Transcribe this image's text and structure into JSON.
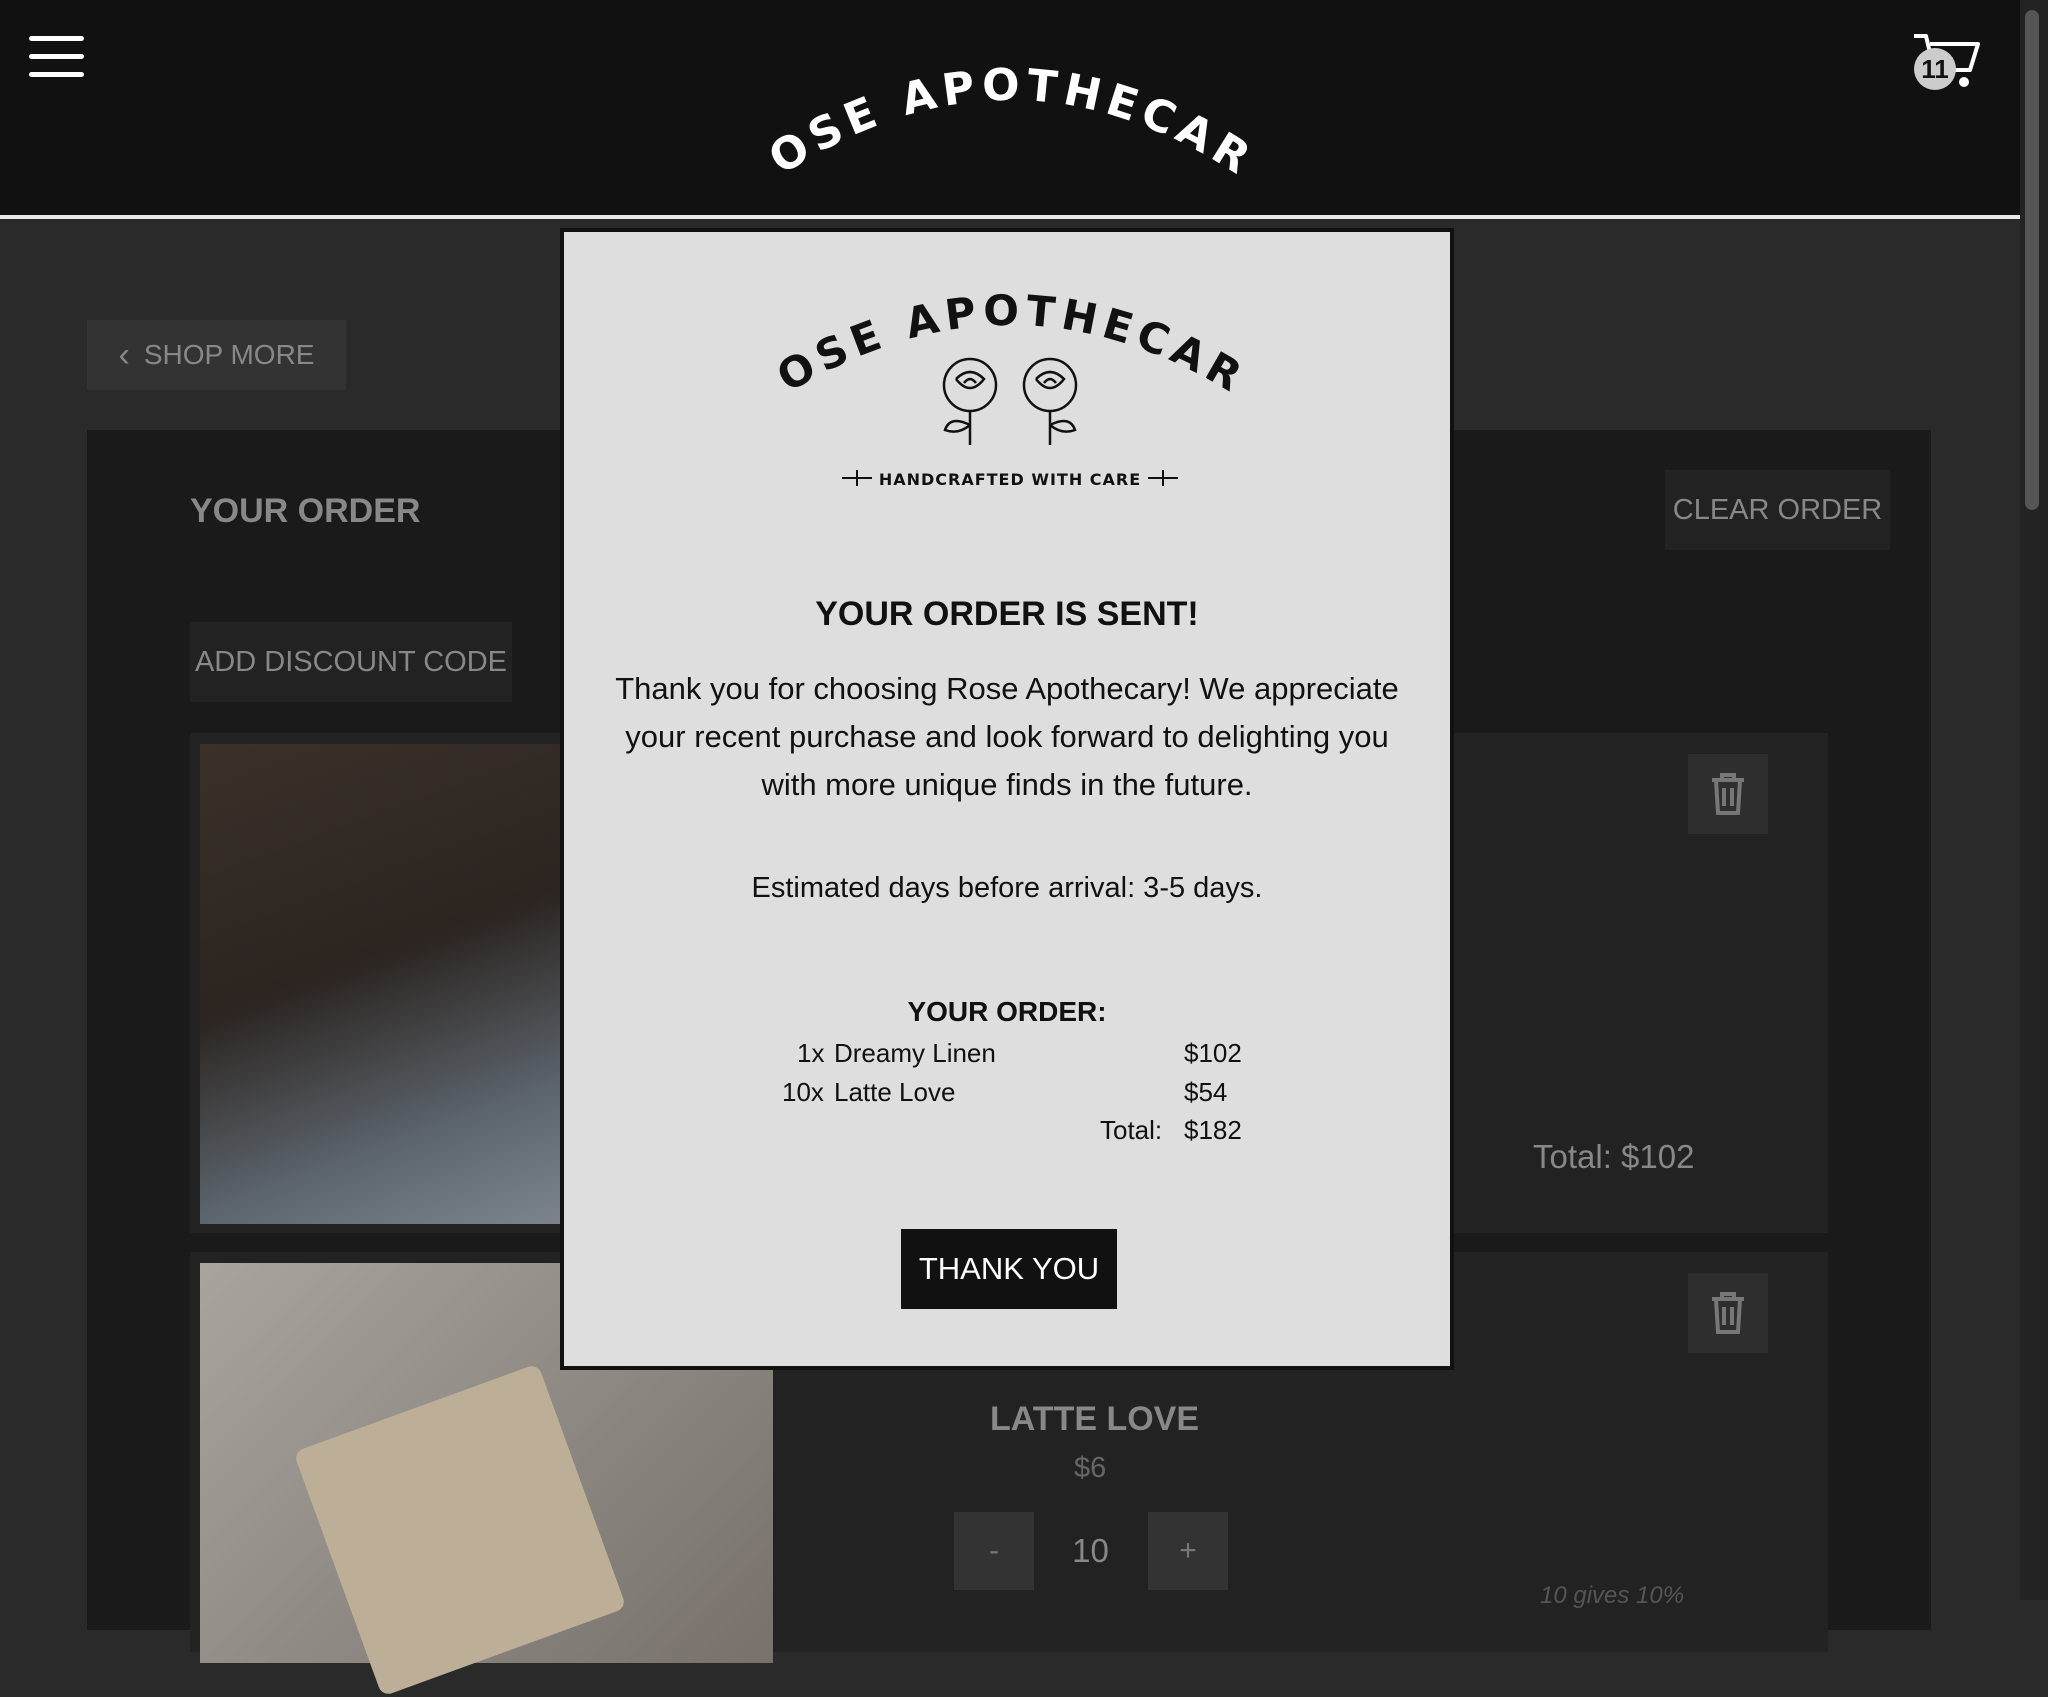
{
  "header": {
    "brand": "ROSE APOTHECARY",
    "cart_count": "11"
  },
  "nav": {
    "shop_more": "SHOP MORE"
  },
  "order": {
    "title": "YOUR ORDER",
    "clear_label": "CLEAR ORDER",
    "discount_label": "ADD DISCOUNT CODE",
    "items": [
      {
        "name": "DREAMY LINEN",
        "price": "$102",
        "quantity": "1",
        "total": "Total: $102"
      },
      {
        "name": "LATTE LOVE",
        "price": "$6",
        "quantity": "10",
        "note": "10 gives 10%"
      }
    ],
    "minus": "-",
    "plus": "+"
  },
  "modal": {
    "brand": "ROSE APOTHECARY",
    "tagline": "HANDCRAFTED WITH CARE",
    "title": "YOUR ORDER IS SENT!",
    "message": "Thank you for choosing Rose Apothecary! We appreciate your recent purchase and look forward to delighting you with more unique finds in the future.",
    "estimate": "Estimated days before arrival: 3-5 days.",
    "summary_title": "YOUR ORDER:",
    "summary": [
      {
        "qty": "1x",
        "name": "Dreamy Linen",
        "price": "$102"
      },
      {
        "qty": "10x",
        "name": "Latte Love",
        "price": "$54"
      }
    ],
    "total_label": "Total:",
    "total_value": "$182",
    "button": "THANK YOU"
  }
}
